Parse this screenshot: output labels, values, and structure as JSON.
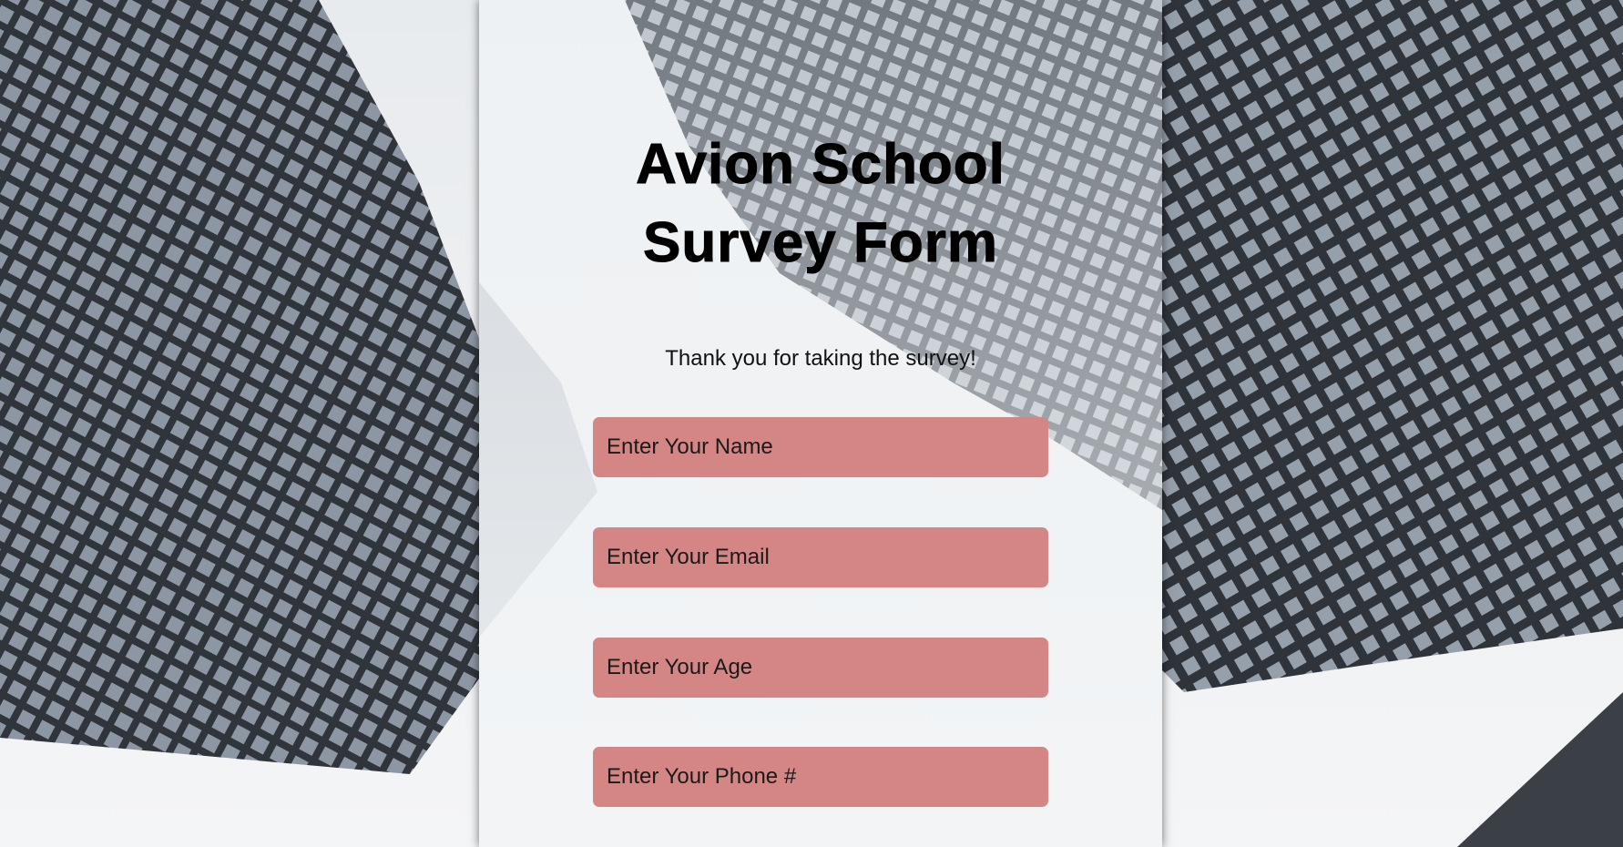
{
  "page": {
    "title_line1": "Avion School",
    "title_line2": "Survey Form",
    "description": "Thank you for taking the survey!"
  },
  "form": {
    "name_placeholder": "Enter Your Name",
    "email_placeholder": "Enter Your Email",
    "age_placeholder": "Enter Your Age",
    "phone_placeholder": "Enter Your Phone #"
  },
  "colors": {
    "field_background": "#d48684",
    "title_text": "#000000"
  },
  "icons": {
    "background": "skyscraper-photo"
  }
}
